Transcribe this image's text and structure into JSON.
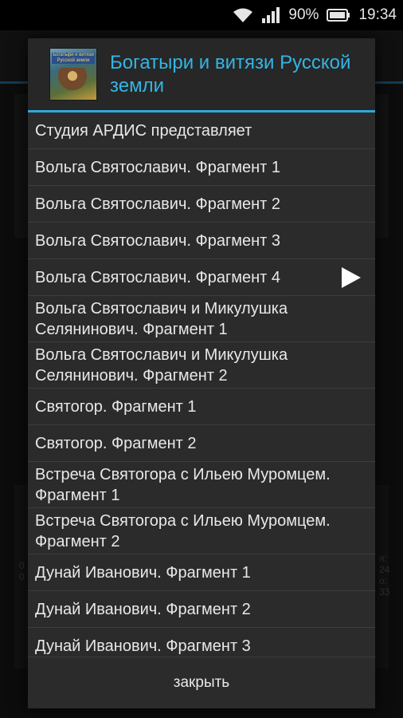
{
  "status_bar": {
    "battery_percent": "90%",
    "time": "19:34",
    "icons": [
      "wifi-icon",
      "signal-icon",
      "battery-icon"
    ]
  },
  "background": {
    "side_text_right": [
      "я:",
      "24",
      "о:",
      "33"
    ],
    "side_text_left": [
      "0",
      "0"
    ]
  },
  "dialog": {
    "title": "Богатыри и витязи Русской земли",
    "cover_band_text": "Богатыри и витязи Русской земли",
    "accent_color": "#33b5e5",
    "items": [
      {
        "label": "Студия АРДИС представляет",
        "lines": 1,
        "playing": false
      },
      {
        "label": "Вольга Святославич. Фрагмент 1",
        "lines": 1,
        "playing": false
      },
      {
        "label": "Вольга Святославич. Фрагмент 2",
        "lines": 1,
        "playing": false
      },
      {
        "label": "Вольга Святославич. Фрагмент 3",
        "lines": 1,
        "playing": false
      },
      {
        "label": "Вольга Святославич. Фрагмент 4",
        "lines": 1,
        "playing": true
      },
      {
        "label": "Вольга Святославич и Микулушка Селянинович. Фрагмент 1",
        "lines": 2,
        "playing": false
      },
      {
        "label": "Вольга Святославич и Микулушка Селянинович. Фрагмент 2",
        "lines": 2,
        "playing": false
      },
      {
        "label": "Святогор. Фрагмент 1",
        "lines": 1,
        "playing": false
      },
      {
        "label": "Святогор. Фрагмент 2",
        "lines": 1,
        "playing": false
      },
      {
        "label": "Встреча Святогора с Ильею Муромцем. Фрагмент 1",
        "lines": 2,
        "playing": false
      },
      {
        "label": "Встреча Святогора с Ильею Муромцем. Фрагмент 2",
        "lines": 2,
        "playing": false
      },
      {
        "label": "Дунай Иванович. Фрагмент 1",
        "lines": 1,
        "playing": false
      },
      {
        "label": "Дунай Иванович. Фрагмент 2",
        "lines": 1,
        "playing": false
      },
      {
        "label": "Дунай Иванович. Фрагмент 3",
        "lines": 1,
        "playing": false
      }
    ],
    "close_label": "закрыть"
  }
}
